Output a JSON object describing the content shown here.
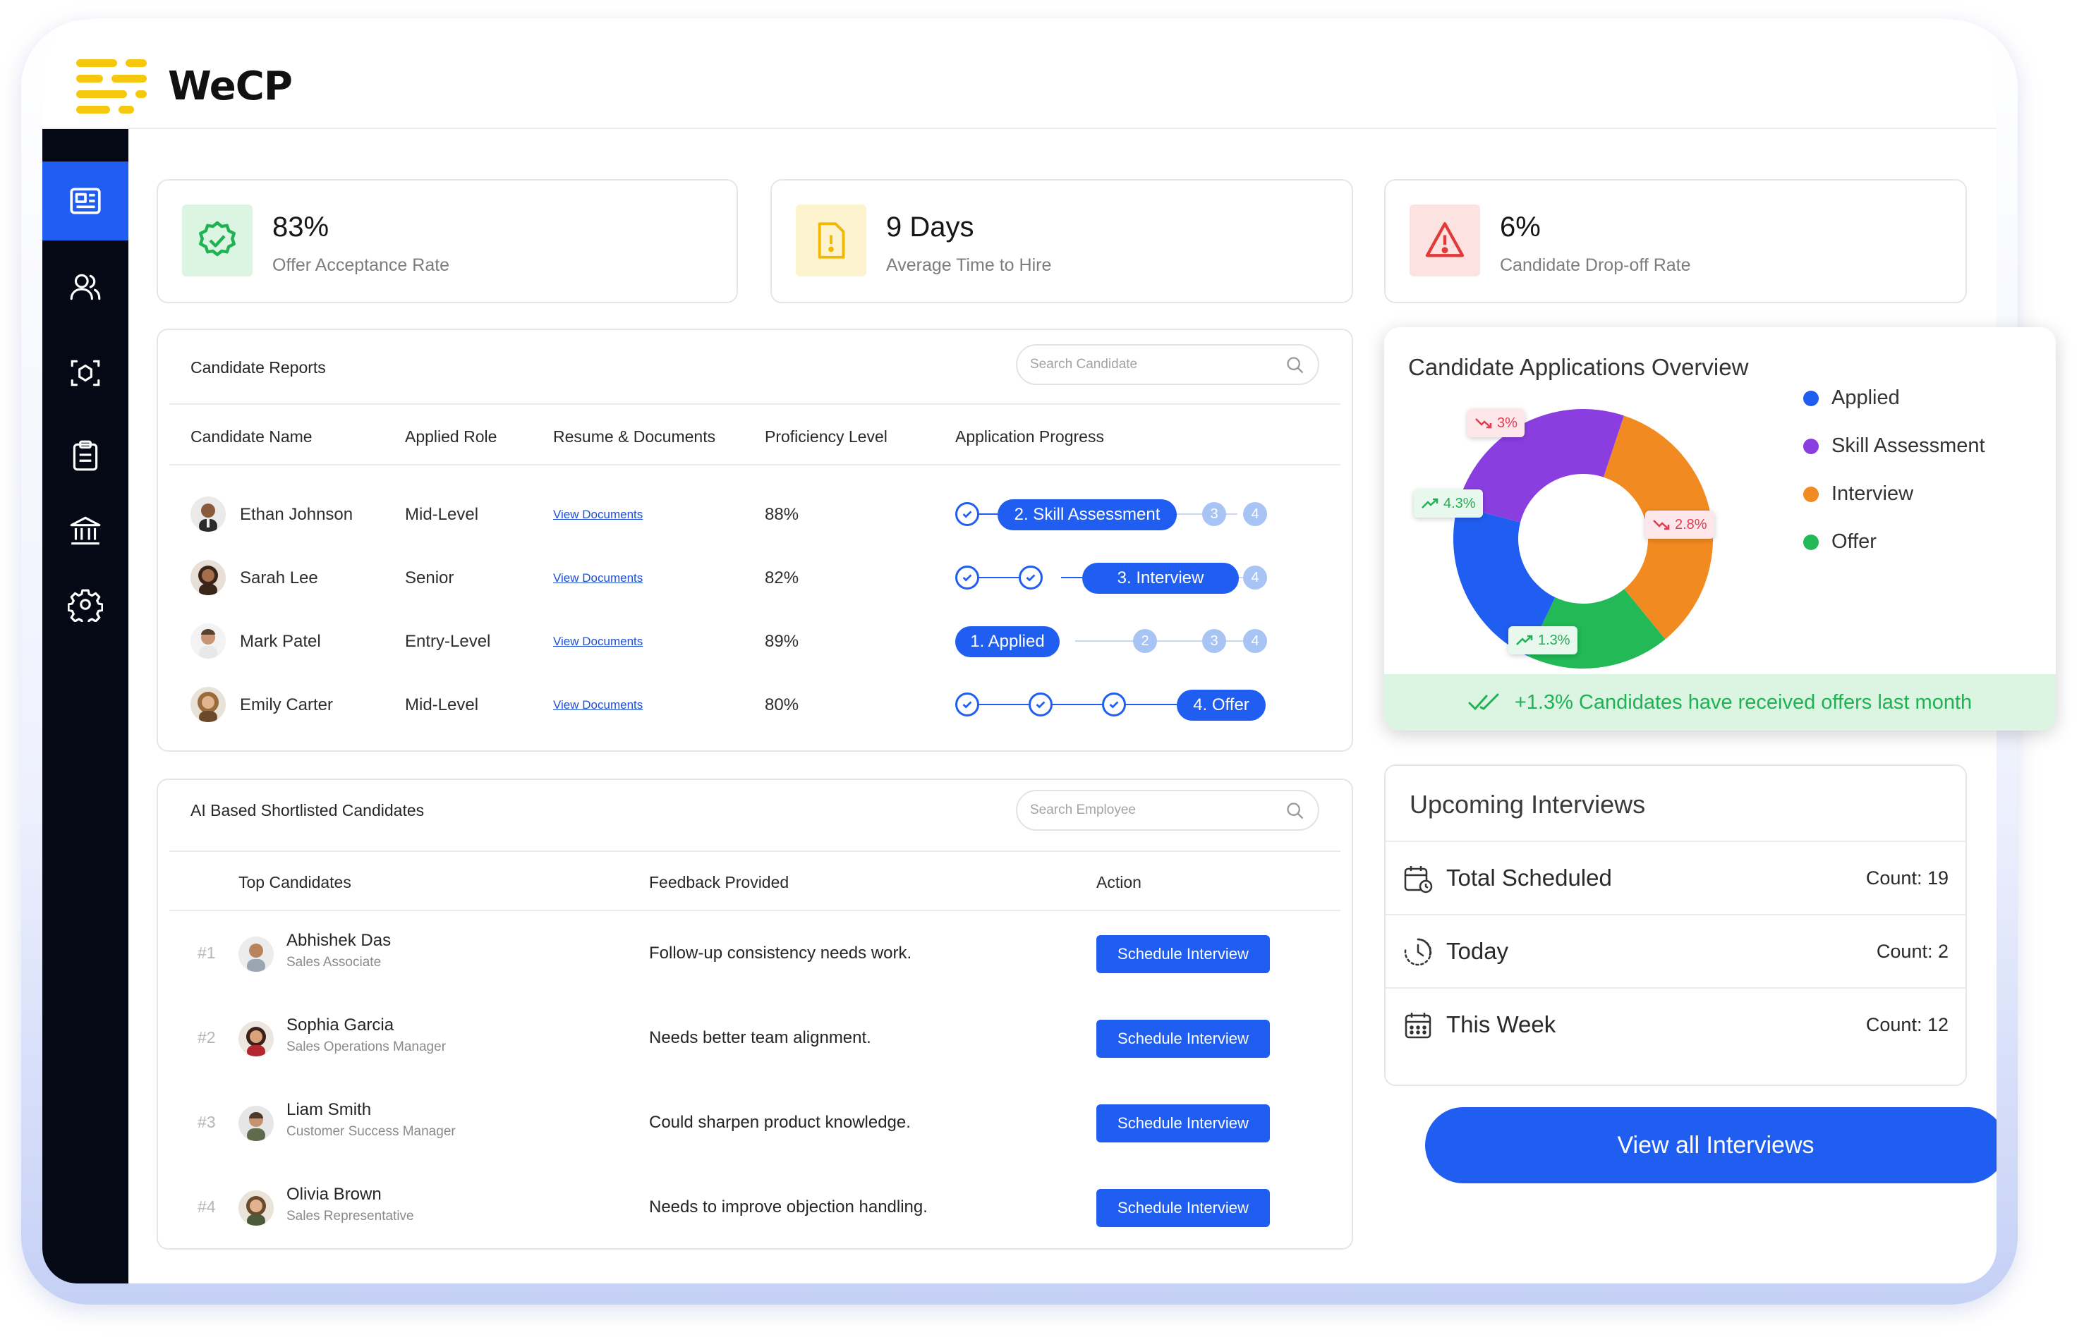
{
  "app": {
    "name": "WeCP"
  },
  "stats": [
    {
      "value": "83%",
      "label": "Offer Acceptance Rate",
      "icon": "badge-check-icon",
      "color": "#1fb253",
      "bg": "#dcf5e3"
    },
    {
      "value": "9 Days",
      "label": "Average Time to Hire",
      "icon": "document-alert-icon",
      "color": "#f0b800",
      "bg": "#fdf3cf"
    },
    {
      "value": "6%",
      "label": "Candidate Drop-off Rate",
      "icon": "warning-triangle-icon",
      "color": "#e23a3a",
      "bg": "#fde2e2"
    }
  ],
  "reports": {
    "title": "Candidate Reports",
    "search_placeholder": "Search Candidate",
    "headers": [
      "Candidate Name",
      "Applied Role",
      "Resume & Documents",
      "Proficiency Level",
      "Application Progress"
    ],
    "rows": [
      {
        "name": "Ethan Johnson",
        "role": "Mid-Level",
        "docs": "View Documents",
        "proficiency": "88%",
        "stage": "2. Skill Assessment"
      },
      {
        "name": "Sarah Lee",
        "role": "Senior",
        "docs": "View Documents",
        "proficiency": "82%",
        "stage": "3. Interview"
      },
      {
        "name": "Mark Patel",
        "role": "Entry-Level",
        "docs": "View Documents",
        "proficiency": "89%",
        "stage": "1. Applied"
      },
      {
        "name": "Emily Carter",
        "role": "Mid-Level",
        "docs": "View Documents",
        "proficiency": "80%",
        "stage": "4. Offer"
      }
    ],
    "step_numbers": [
      "2",
      "3",
      "4"
    ]
  },
  "shortlist": {
    "title": "AI Based Shortlisted Candidates",
    "search_placeholder": "Search Employee",
    "headers": [
      "Top Candidates",
      "Feedback Provided",
      "Action"
    ],
    "rows": [
      {
        "rank": "#1",
        "name": "Abhishek Das",
        "role": "Sales Associate",
        "feedback": "Follow-up consistency needs work.",
        "action": "Schedule Interview"
      },
      {
        "rank": "#2",
        "name": "Sophia Garcia",
        "role": "Sales Operations Manager",
        "feedback": "Needs better team alignment.",
        "action": "Schedule Interview"
      },
      {
        "rank": "#3",
        "name": "Liam Smith",
        "role": "Customer Success Manager",
        "feedback": "Could sharpen product knowledge.",
        "action": "Schedule Interview"
      },
      {
        "rank": "#4",
        "name": "Olivia Brown",
        "role": "Sales Representative",
        "feedback": "Needs to improve objection handling.",
        "action": "Schedule Interview"
      }
    ]
  },
  "overview": {
    "title": "Candidate Applications Overview",
    "legend": [
      {
        "label": "Applied",
        "color": "#1f5ef0"
      },
      {
        "label": "Skill Assessment",
        "color": "#8a3ee0"
      },
      {
        "label": "Interview",
        "color": "#f28a22"
      },
      {
        "label": "Offer",
        "color": "#22b956"
      }
    ],
    "badges": {
      "skill": "3%",
      "interview": "2.8%",
      "applied": "4.3%",
      "offer": "1.3%"
    },
    "footer": "+1.3% Candidates have received offers last month"
  },
  "chart_data": {
    "type": "pie",
    "categories": [
      "Applied",
      "Skill Assessment",
      "Interview",
      "Offer"
    ],
    "values": [
      22,
      26,
      34,
      18
    ],
    "annotations": [
      "3%",
      "2.8%",
      "4.3%",
      "1.3%"
    ]
  },
  "upcoming": {
    "title": "Upcoming Interviews",
    "rows": [
      {
        "label": "Total Scheduled",
        "count": "Count: 19",
        "icon": "calendar-clock-icon"
      },
      {
        "label": "Today",
        "count": "Count: 2",
        "icon": "clock-icon"
      },
      {
        "label": "This Week",
        "count": "Count: 12",
        "icon": "calendar-icon"
      }
    ],
    "button": "View all Interviews"
  }
}
